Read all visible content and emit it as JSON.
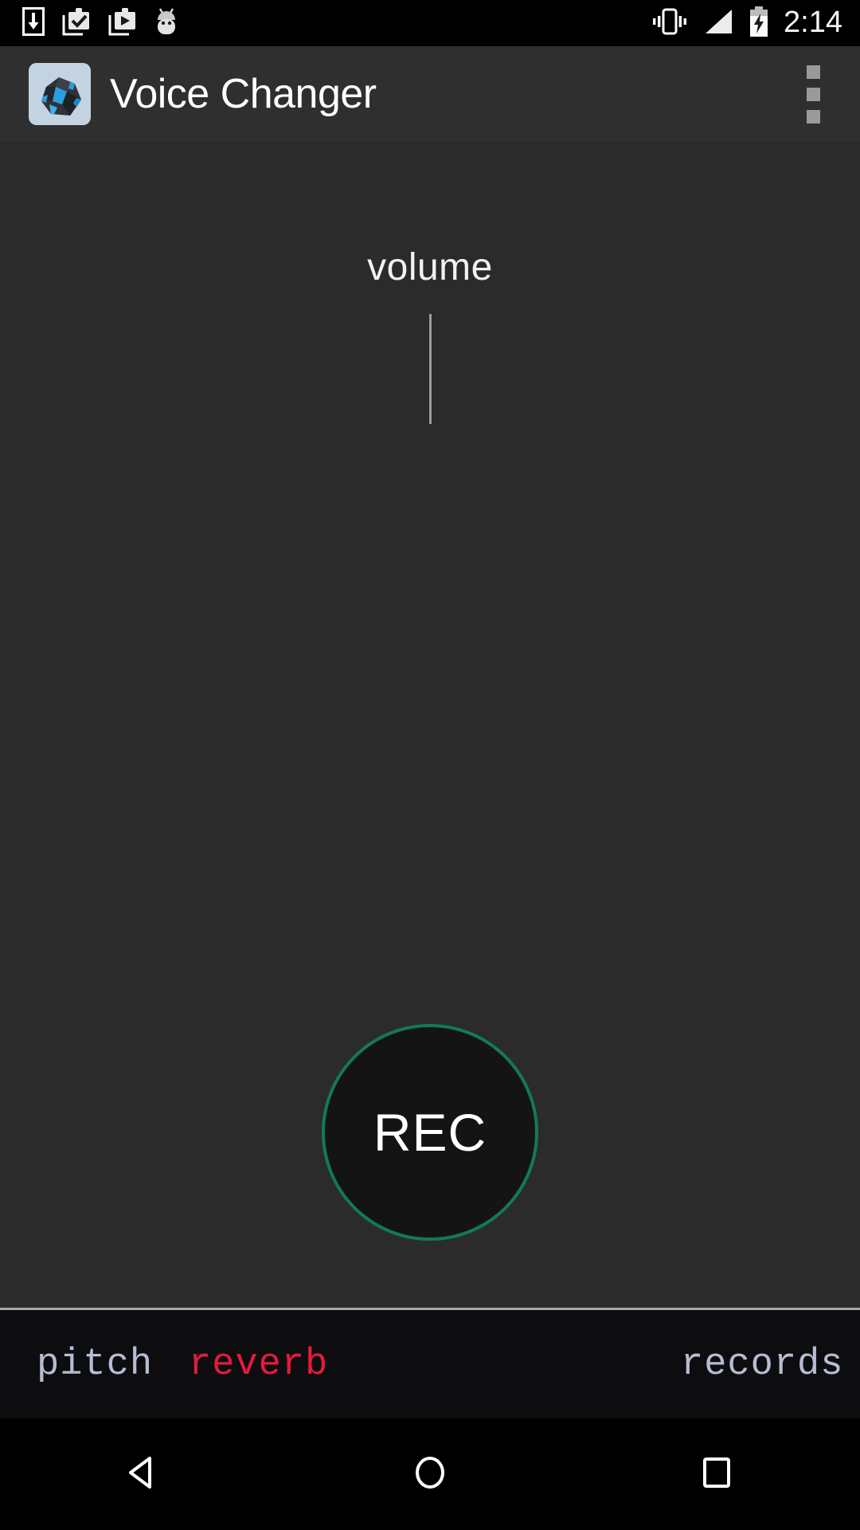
{
  "status_bar": {
    "time": "2:14",
    "left_icons": [
      {
        "name": "download-icon",
        "label": "download"
      },
      {
        "name": "install-complete-icon",
        "label": "install complete"
      },
      {
        "name": "play-store-icon",
        "label": "play store"
      },
      {
        "name": "android-icon",
        "label": "android"
      }
    ],
    "right_icons": [
      {
        "name": "vibrate-icon",
        "label": "vibrate"
      },
      {
        "name": "signal-icon",
        "label": "signal"
      },
      {
        "name": "battery-charging-icon",
        "label": "battery charging"
      }
    ]
  },
  "action_bar": {
    "title": "Voice Changer",
    "app_icon_name": "voice-changer-app-icon",
    "overflow_label": "More options"
  },
  "main": {
    "volume": {
      "label": "volume",
      "slider_name": "volume-slider"
    },
    "record": {
      "label": "REC"
    }
  },
  "tabs": [
    {
      "id": "pitch",
      "label": "pitch",
      "color": "#b6bdd2",
      "selected": false
    },
    {
      "id": "reverb",
      "label": "reverb",
      "color": "#e31b3d",
      "selected": true
    },
    {
      "id": "records",
      "label": "records",
      "color": "#b6bdd2",
      "selected": false
    }
  ],
  "nav_bar": {
    "back": "Back",
    "home": "Home",
    "recents": "Recent apps"
  },
  "colors": {
    "background": "#2b2b2b",
    "action_bar": "#2f2f2f",
    "tab_bar": "#0d0d10",
    "rec_border": "#147a51",
    "rec_fill": "#141414",
    "accent_red": "#e31b3d",
    "accent_blue_gray": "#b6bdd2"
  }
}
